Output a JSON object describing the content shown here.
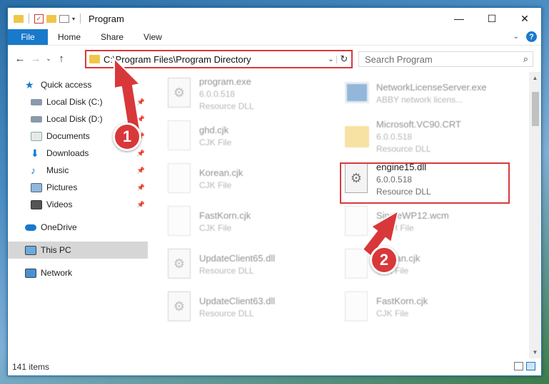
{
  "window": {
    "title": "Program",
    "controls": {
      "minimize": "—",
      "maximize": "☐",
      "close": "✕"
    }
  },
  "ribbon": {
    "file_tab": "File",
    "tabs": [
      "Home",
      "Share",
      "View"
    ],
    "help": "?"
  },
  "address": {
    "path": "C:\\Program Files\\Program Directory",
    "search_placeholder": "Search Program"
  },
  "nav_pane": {
    "quick_access": "Quick access",
    "items": [
      {
        "label": "Local Disk (C:)",
        "icon": "drive-icon",
        "pinned": true
      },
      {
        "label": "Local Disk (D:)",
        "icon": "drive-icon",
        "pinned": true
      },
      {
        "label": "Documents",
        "icon": "documents-icon",
        "pinned": true
      },
      {
        "label": "Downloads",
        "icon": "downloads-icon",
        "pinned": true
      },
      {
        "label": "Music",
        "icon": "music-icon",
        "pinned": true
      },
      {
        "label": "Pictures",
        "icon": "pictures-icon",
        "pinned": true
      },
      {
        "label": "Videos",
        "icon": "videos-icon",
        "pinned": true
      }
    ],
    "onedrive": "OneDrive",
    "this_pc": "This PC",
    "network": "Network"
  },
  "files": [
    {
      "name": "program.exe",
      "sub1": "6.0.0.518",
      "sub2": "Resource DLL",
      "icon": "gear-doc-icon"
    },
    {
      "name": "NetworkLicenseServer.exe",
      "sub1": "ABBY network licens...",
      "sub2": "",
      "icon": "app-icon"
    },
    {
      "name": "ghd.cjk",
      "sub1": "CJK File",
      "sub2": "",
      "icon": "document-icon"
    },
    {
      "name": "Microsoft.VC90.CRT",
      "sub1": "6.0.0.518",
      "sub2": "Resource DLL",
      "icon": "folder-icon"
    },
    {
      "name": "Korean.cjk",
      "sub1": "CJK File",
      "sub2": "",
      "icon": "document-icon"
    },
    {
      "name": "engine15.dll",
      "sub1": "6.0.0.518",
      "sub2": "Resource DLL",
      "icon": "gear-doc-icon"
    },
    {
      "name": "FastKorn.cjk",
      "sub1": "CJK File",
      "sub2": "",
      "icon": "document-icon"
    },
    {
      "name": "SingleWP12.wcm",
      "sub1": "WCM File",
      "sub2": "",
      "icon": "document-icon"
    },
    {
      "name": "UpdateClient65.dll",
      "sub1": "Resource DLL",
      "sub2": "",
      "icon": "gear-doc-icon"
    },
    {
      "name": "Korean.cjk",
      "sub1": "CJK File",
      "sub2": "",
      "icon": "document-icon"
    },
    {
      "name": "UpdateClient63.dll",
      "sub1": "Resource DLL",
      "sub2": "",
      "icon": "gear-doc-icon"
    },
    {
      "name": "FastKorn.cjk",
      "sub1": "CJK File",
      "sub2": "",
      "icon": "document-icon"
    }
  ],
  "status": {
    "count": "141 items"
  },
  "annotations": {
    "step1": "1",
    "step2": "2"
  },
  "colors": {
    "accent": "#1979ca",
    "highlight": "#d9383a",
    "folder": "#f0c64a"
  }
}
